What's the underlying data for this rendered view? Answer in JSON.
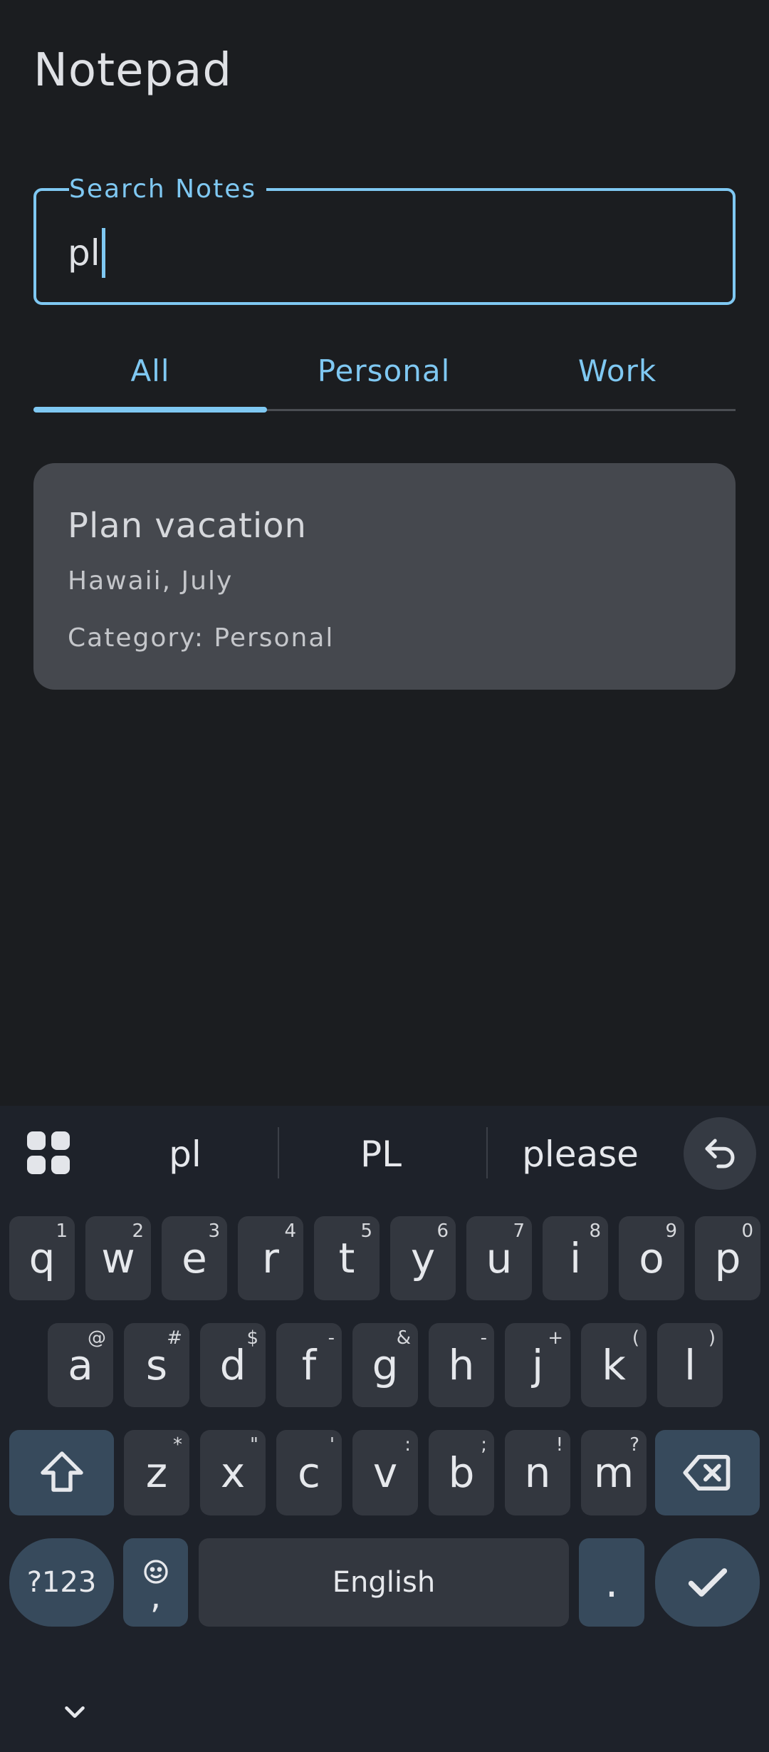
{
  "app": {
    "title": "Notepad"
  },
  "search": {
    "label": "Search Notes",
    "value": "pl"
  },
  "tabs": [
    {
      "label": "All",
      "selected": true
    },
    {
      "label": "Personal",
      "selected": false
    },
    {
      "label": "Work",
      "selected": false
    }
  ],
  "notes": [
    {
      "title": "Plan vacation",
      "body": "Hawaii, July",
      "category": "Category: Personal"
    }
  ],
  "keyboard": {
    "suggestions": [
      "pl",
      "PL",
      "please"
    ],
    "row1": [
      {
        "k": "q",
        "h": "1"
      },
      {
        "k": "w",
        "h": "2"
      },
      {
        "k": "e",
        "h": "3"
      },
      {
        "k": "r",
        "h": "4"
      },
      {
        "k": "t",
        "h": "5"
      },
      {
        "k": "y",
        "h": "6"
      },
      {
        "k": "u",
        "h": "7"
      },
      {
        "k": "i",
        "h": "8"
      },
      {
        "k": "o",
        "h": "9"
      },
      {
        "k": "p",
        "h": "0"
      }
    ],
    "row2": [
      {
        "k": "a",
        "h": "@"
      },
      {
        "k": "s",
        "h": "#"
      },
      {
        "k": "d",
        "h": "$"
      },
      {
        "k": "f",
        "h": "-"
      },
      {
        "k": "g",
        "h": "&"
      },
      {
        "k": "h",
        "h": "-"
      },
      {
        "k": "j",
        "h": "+"
      },
      {
        "k": "k",
        "h": "("
      },
      {
        "k": "l",
        "h": ")"
      }
    ],
    "row3": [
      {
        "k": "z",
        "h": "*"
      },
      {
        "k": "x",
        "h": "\""
      },
      {
        "k": "c",
        "h": "'"
      },
      {
        "k": "v",
        "h": ":"
      },
      {
        "k": "b",
        "h": ";"
      },
      {
        "k": "n",
        "h": "!"
      },
      {
        "k": "m",
        "h": "?"
      }
    ],
    "symbols_label": "?123",
    "comma_label": ",",
    "space_label": "English",
    "period_label": "."
  },
  "icons": {
    "apps": "apps-grid-icon",
    "undo": "undo-icon",
    "shift": "shift-icon",
    "backspace": "backspace-icon",
    "emoji": "emoji-icon",
    "enter": "checkmark-icon",
    "nav": "chevron-down-icon"
  },
  "colors": {
    "accent": "#7fc8f2",
    "background": "#1b1d20",
    "card": "#45484e"
  }
}
